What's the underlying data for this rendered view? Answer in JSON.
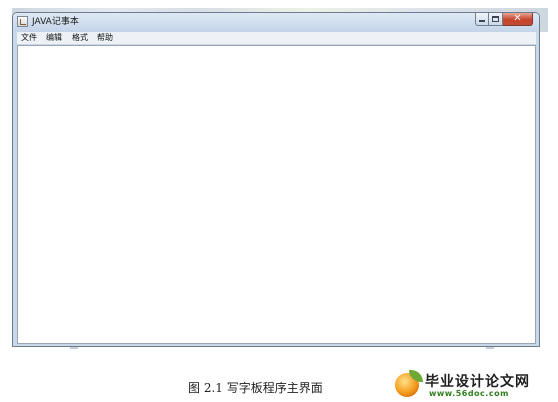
{
  "window": {
    "title": "JAVA记事本",
    "icon": "notepad-app-icon",
    "controls": {
      "minimize_icon": "minimize-icon",
      "maximize_icon": "maximize-icon",
      "close_icon": "close-icon",
      "close_glyph": "✕"
    }
  },
  "menubar": {
    "items": [
      {
        "label": "文件"
      },
      {
        "label": "编辑"
      },
      {
        "label": "格式"
      },
      {
        "label": "帮助"
      }
    ]
  },
  "editor": {
    "value": ""
  },
  "caption": {
    "text": "图 2.1   写字板程序主界面"
  },
  "watermark": {
    "title": "毕业设计论文网",
    "url": "www.56doc.com"
  },
  "colors": {
    "close_button": "#c8432c",
    "frame": "#c9d8e9",
    "watermark_url": "#2f7d1e"
  }
}
